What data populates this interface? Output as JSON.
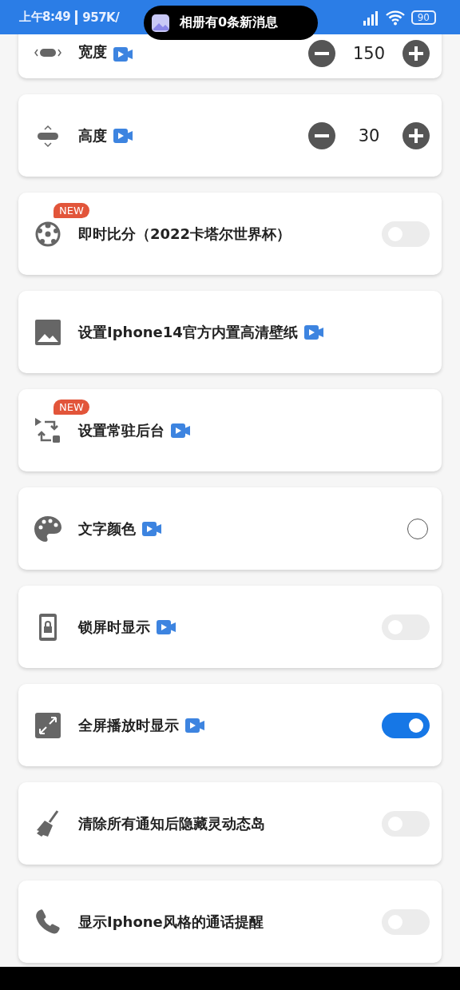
{
  "status_bar": {
    "time": "上午8:49",
    "speed": "957K/",
    "battery": "90"
  },
  "notification": {
    "text": "相册有0条新消息"
  },
  "rows": [
    {
      "kind": "stepper",
      "label": "宽度",
      "video": true,
      "value": "150"
    },
    {
      "kind": "stepper",
      "label": "高度",
      "video": true,
      "value": "30"
    },
    {
      "kind": "switch",
      "label": "即时比分（2022卡塔尔世界杯）",
      "video": false,
      "badge": "NEW",
      "on": false
    },
    {
      "kind": "plain",
      "label": "设置Iphone14官方内置高清壁纸",
      "video": true
    },
    {
      "kind": "plain",
      "label": "设置常驻后台",
      "video": true,
      "badge": "NEW"
    },
    {
      "kind": "radio",
      "label": "文字颜色",
      "video": true,
      "checked": false
    },
    {
      "kind": "switch",
      "label": "锁屏时显示",
      "video": true,
      "on": false
    },
    {
      "kind": "switch",
      "label": "全屏播放时显示",
      "video": true,
      "on": true
    },
    {
      "kind": "switch",
      "label": "清除所有通知后隐藏灵动态岛",
      "video": false,
      "on": false
    },
    {
      "kind": "switch",
      "label": "显示Iphone风格的通话提醒",
      "video": false,
      "on": false
    }
  ]
}
